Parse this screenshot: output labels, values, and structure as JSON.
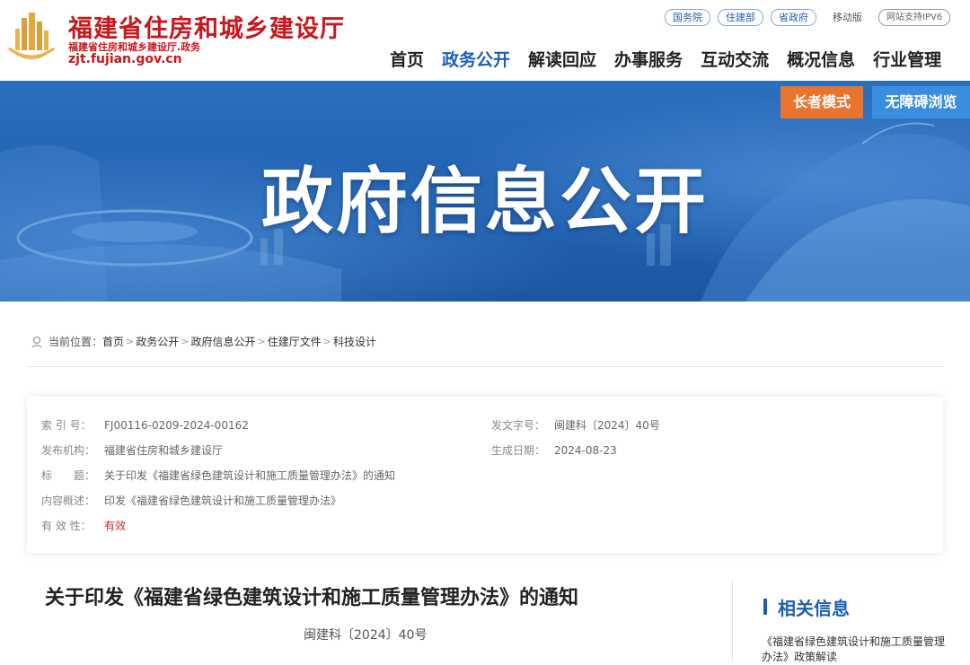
{
  "header": {
    "site_name": "福建省住房和城乡建设厅",
    "site_sub": "福建省住房和城乡建设厅.政务",
    "site_domain": "zjt.fujian.gov.cn",
    "top_links": [
      "国务院",
      "住建部",
      "省政府"
    ],
    "mobile": "移动版",
    "ipv6": "网站支持IPV6"
  },
  "nav": {
    "items": [
      "首页",
      "政务公开",
      "解读回应",
      "办事服务",
      "互动交流",
      "概况信息",
      "行业管理"
    ],
    "active": "政务公开"
  },
  "banner": {
    "title": "政府信息公开",
    "elder_mode": "长者模式",
    "accessible": "无障碍浏览"
  },
  "breadcrumb": {
    "prefix": "当前位置：",
    "items": [
      "首页",
      "政务公开",
      "政府信息公开",
      "住建厅文件",
      "科技设计"
    ]
  },
  "info": {
    "index_label": "索 引 号：",
    "index_value": "FJ00116-0209-2024-00162",
    "docno_label": "发文字号：",
    "docno_value": "闽建科〔2024〕40号",
    "org_label": "发布机构：",
    "org_value": "福建省住房和城乡建设厅",
    "date_label": "生成日期：",
    "date_value": "2024-08-23",
    "title_label": "标　　题：",
    "title_value": "关于印发《福建省绿色建筑设计和施工质量管理办法》的通知",
    "summary_label": "内容概述：",
    "summary_value": "印发《福建省绿色建筑设计和施工质量管理办法》",
    "valid_label": "有 效 性：",
    "valid_value": "有效"
  },
  "article": {
    "title": "关于印发《福建省绿色建筑设计和施工质量管理办法》的通知",
    "doc_number": "闽建科〔2024〕40号"
  },
  "related": {
    "title": "相关信息",
    "items": [
      "《福建省绿色建筑设计和施工质量管理办法》政策解读"
    ]
  },
  "colors": {
    "brand_red": "#c8171e",
    "brand_blue": "#1c5fb0",
    "elder_orange": "#e8742d"
  }
}
